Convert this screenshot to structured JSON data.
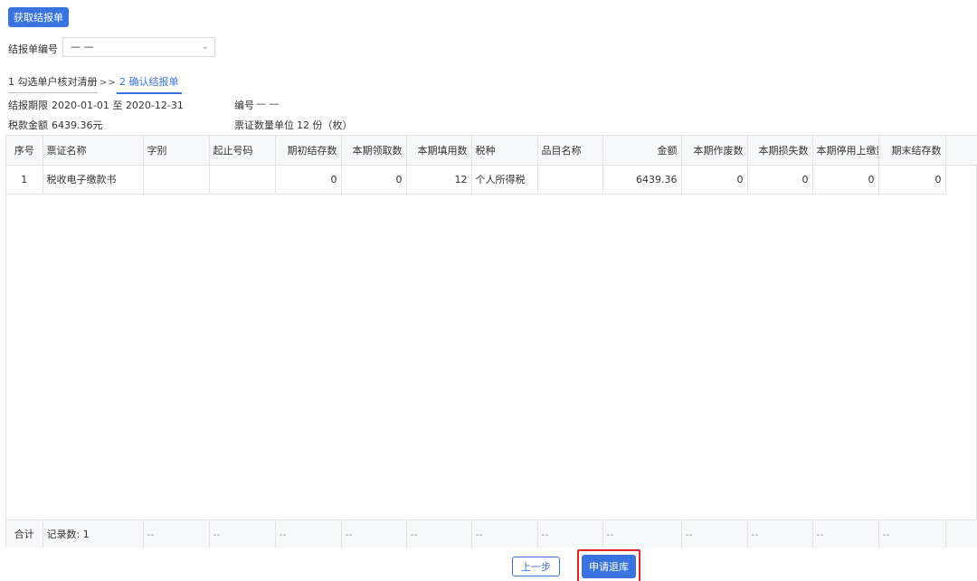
{
  "toolbar": {
    "fetch_label": "获取结报单"
  },
  "form": {
    "report_no_label": "结报单编号",
    "report_no_value": "— —"
  },
  "steps": {
    "step1": "1 勾选单户核对清册",
    "separator": ">>",
    "step2": "2 确认结报单"
  },
  "info": {
    "period_label": "结报期限",
    "period_value": "2020-01-01 至 2020-12-31",
    "code_label": "编号",
    "code_value": "— —",
    "tax_label": "税款金额",
    "tax_value": "6439.36元",
    "unit_label": "票证数量单位",
    "unit_value": "12 份（枚）"
  },
  "table": {
    "headers": [
      "序号",
      "票证名称",
      "字别",
      "起止号码",
      "期初结存数",
      "本期领取数",
      "本期填用数",
      "税种",
      "品目名称",
      "金额",
      "本期作废数",
      "本期损失数",
      "本期停用上缴数",
      "期末结存数"
    ],
    "rows": [
      [
        "1",
        "税收电子缴款书",
        "",
        "",
        "0",
        "0",
        "12",
        "个人所得税",
        "",
        "6439.36",
        "0",
        "0",
        "0",
        "0"
      ]
    ],
    "footer": [
      "合计",
      "记录数: 1",
      "--",
      "--",
      "--",
      "--",
      "--",
      "--",
      "--",
      "--",
      "--",
      "--",
      "--",
      "--"
    ]
  },
  "actions": {
    "prev_label": "上一步",
    "apply_label": "申请退库"
  }
}
